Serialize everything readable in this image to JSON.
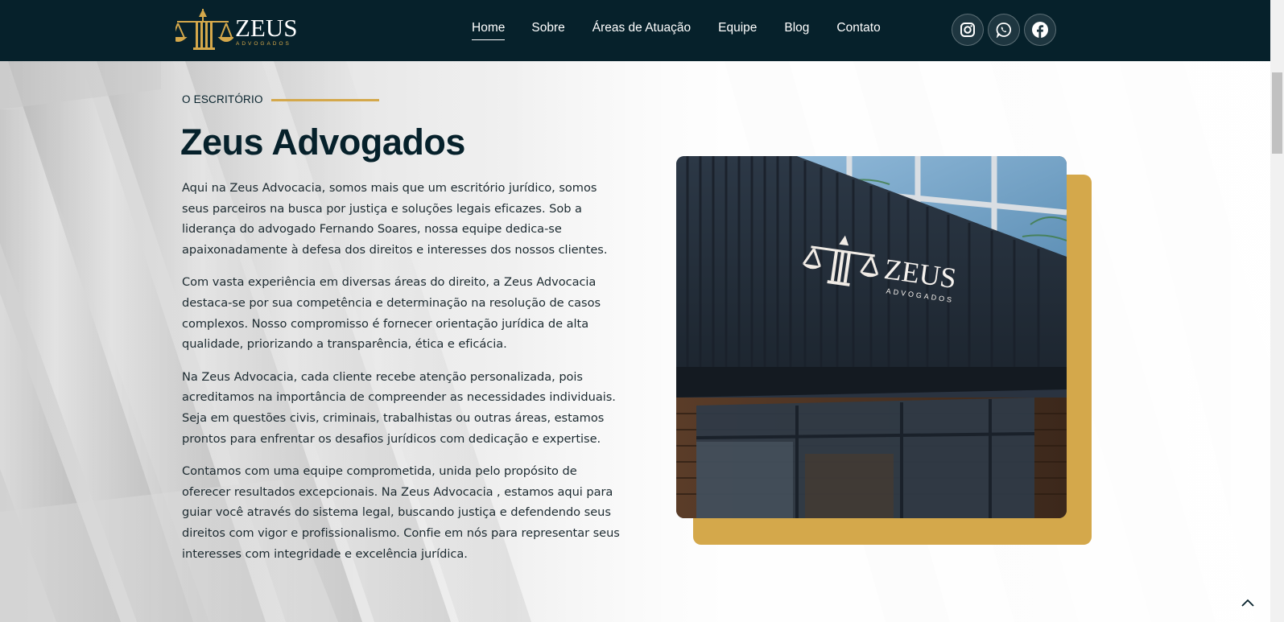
{
  "header": {
    "logo": {
      "word": "ZEUS",
      "sub": "ADVOGADOS"
    },
    "nav": [
      {
        "label": "Home",
        "active": true
      },
      {
        "label": "Sobre"
      },
      {
        "label": "Áreas de Atuação"
      },
      {
        "label": "Equipe"
      },
      {
        "label": "Blog"
      },
      {
        "label": "Contato"
      }
    ],
    "social": [
      "instagram-icon",
      "whatsapp-icon",
      "facebook-icon"
    ]
  },
  "about": {
    "eyebrow": "O ESCRITÓRIO",
    "title": "Zeus Advogados",
    "paragraphs": [
      "Aqui na Zeus Advocacia, somos mais que um escritório jurídico, somos seus parceiros na busca por justiça e soluções legais eficazes. Sob a liderança do advogado Fernando Soares, nossa equipe dedica-se apaixonadamente à defesa dos direitos e interesses dos nossos clientes.",
      "Com vasta experiência em diversas áreas do direito, a Zeus Advocacia destaca-se por sua competência e determinação na resolução de casos complexos. Nosso compromisso é fornecer orientação jurídica de alta qualidade, priorizando a transparência, ética e eficácia.",
      "Na Zeus Advocacia, cada cliente recebe atenção personalizada, pois acreditamos na importância de compreender as necessidades individuais. Seja em questões civis, criminais, trabalhistas ou outras áreas, estamos prontos para enfrentar os desafios jurídicos com dedicação e expertise.",
      "Contamos com uma equipe comprometida, unida pelo propósito de oferecer resultados excepcionais. Na Zeus Advocacia , estamos aqui para guiar você através do sistema legal, buscando justiça e defendendo seus direitos com vigor e profissionalismo. Confie em nós para representar seus interesses com integridade e excelência jurídica."
    ],
    "photo_sign": {
      "word": "ZEUS",
      "sub": "ADVOGADOS"
    }
  },
  "colors": {
    "header_bg": "#06212b",
    "accent_gold": "#d4a84b",
    "text_dark": "#06212b"
  }
}
